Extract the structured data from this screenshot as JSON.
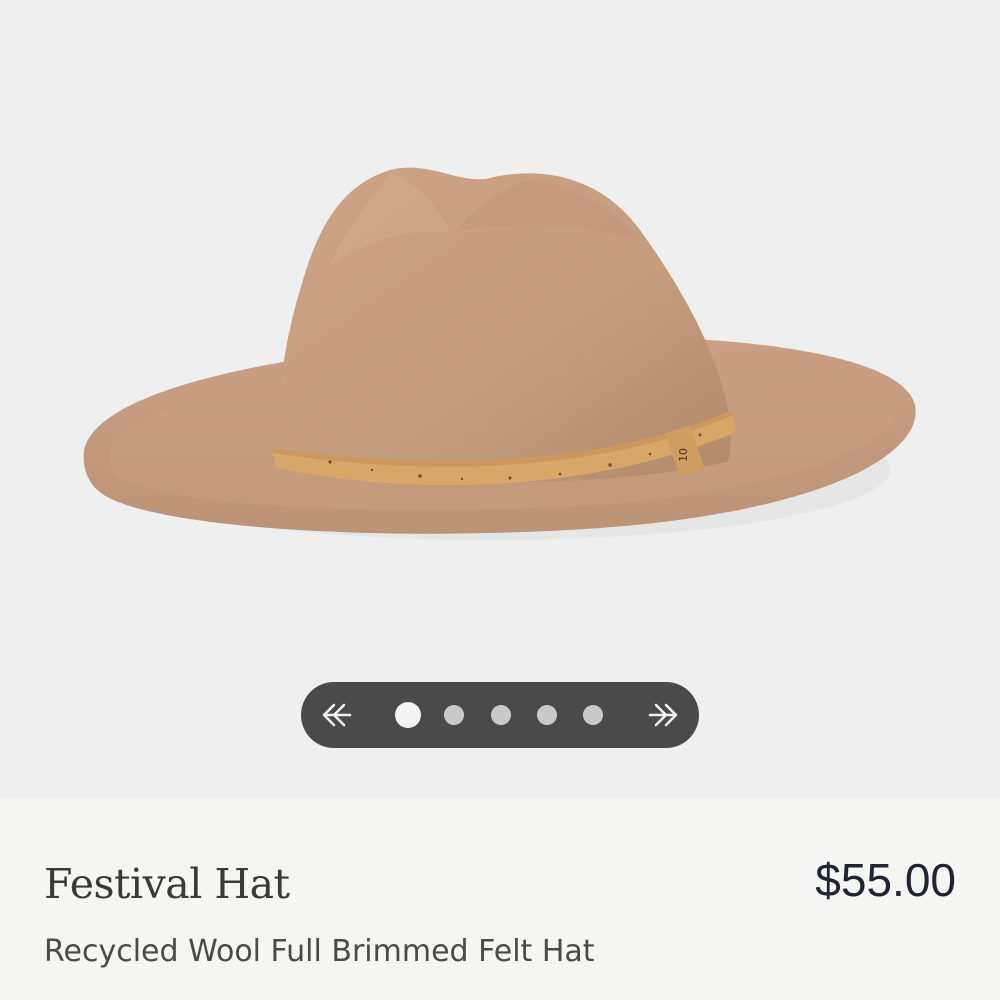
{
  "carousel": {
    "prev_icon": "double-arrow-left-icon",
    "next_icon": "double-arrow-right-icon",
    "dot_count": 5,
    "active_index": 0
  },
  "product": {
    "name": "Festival Hat",
    "subtitle": "Recycled Wool Full Brimmed Felt Hat",
    "price": "$55.00",
    "image_alt_icon": "felt-hat-image",
    "band_logo": "10"
  },
  "colors": {
    "felt": "#c49d7e",
    "band": "#d9a66a",
    "nav_background": "#4a4a4a",
    "price_text": "#1f2430"
  }
}
